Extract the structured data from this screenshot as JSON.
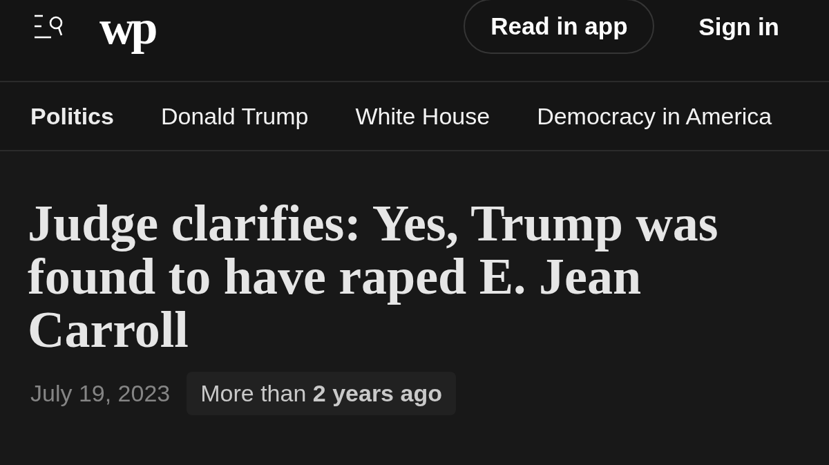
{
  "header": {
    "logo_text": "wp",
    "buttons": [
      {
        "label": "Read in app",
        "kind": "outlined"
      },
      {
        "label": "Sign in",
        "kind": "plain"
      }
    ]
  },
  "nav": {
    "items": [
      {
        "label": "Politics",
        "selected": true
      },
      {
        "label": "Donald Trump",
        "selected": false
      },
      {
        "label": "White House",
        "selected": false
      },
      {
        "label": "Democracy in America",
        "selected": false
      }
    ]
  },
  "article": {
    "headline": "Judge clarifies: Yes, Trump was found to have raped E. Jean Carroll",
    "date": "July 19, 2023",
    "age_badge": "More than **2 years ago**"
  }
}
